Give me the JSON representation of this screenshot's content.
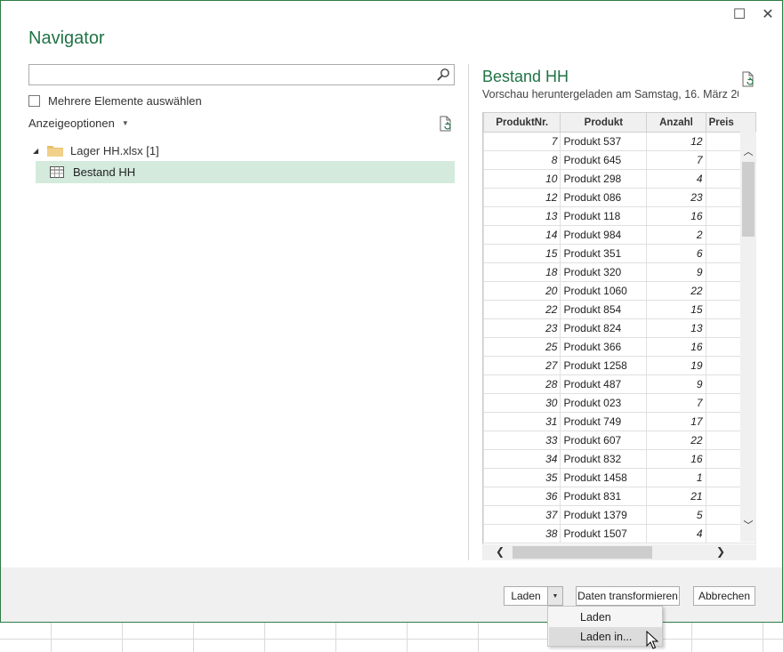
{
  "window": {
    "title": "Navigator",
    "maximize_glyph": "☐",
    "close_glyph": "✕"
  },
  "left": {
    "search_value": "",
    "multi_select_label": "Mehrere Elemente auswählen",
    "display_options_label": "Anzeigeoptionen",
    "tree": {
      "file_label": "Lager HH.xlsx [1]",
      "table_label": "Bestand HH"
    }
  },
  "preview": {
    "title": "Bestand HH",
    "subtitle": "Vorschau heruntergeladen am Samstag, 16. März 20...",
    "columns": [
      "ProduktNr.",
      "Produkt",
      "Anzahl",
      "Preis"
    ],
    "rows": [
      [
        "7",
        "Produkt 537",
        "12"
      ],
      [
        "8",
        "Produkt 645",
        "7"
      ],
      [
        "10",
        "Produkt 298",
        "4"
      ],
      [
        "12",
        "Produkt 086",
        "23"
      ],
      [
        "13",
        "Produkt 118",
        "16"
      ],
      [
        "14",
        "Produkt 984",
        "2"
      ],
      [
        "15",
        "Produkt 351",
        "6"
      ],
      [
        "18",
        "Produkt 320",
        "9"
      ],
      [
        "20",
        "Produkt 1060",
        "22"
      ],
      [
        "22",
        "Produkt 854",
        "15"
      ],
      [
        "23",
        "Produkt 824",
        "13"
      ],
      [
        "25",
        "Produkt 366",
        "16"
      ],
      [
        "27",
        "Produkt 1258",
        "19"
      ],
      [
        "28",
        "Produkt 487",
        "9"
      ],
      [
        "30",
        "Produkt 023",
        "7"
      ],
      [
        "31",
        "Produkt 749",
        "17"
      ],
      [
        "33",
        "Produkt 607",
        "22"
      ],
      [
        "34",
        "Produkt 832",
        "16"
      ],
      [
        "35",
        "Produkt 1458",
        "1"
      ],
      [
        "36",
        "Produkt 831",
        "21"
      ],
      [
        "37",
        "Produkt 1379",
        "5"
      ],
      [
        "38",
        "Produkt 1507",
        "4"
      ]
    ]
  },
  "footer": {
    "load_label": "Laden",
    "transform_label": "Daten transformieren",
    "cancel_label": "Abbrechen"
  },
  "load_menu": {
    "items": [
      "Laden",
      "Laden in..."
    ],
    "hovered": "Laden in..."
  },
  "colors": {
    "accent": "#217346",
    "selection": "#d3eadd",
    "border": "#2e7d46"
  },
  "icons": {
    "search": "search-icon",
    "refresh": "refresh-icon",
    "folder": "folder-icon",
    "table": "table-icon"
  }
}
